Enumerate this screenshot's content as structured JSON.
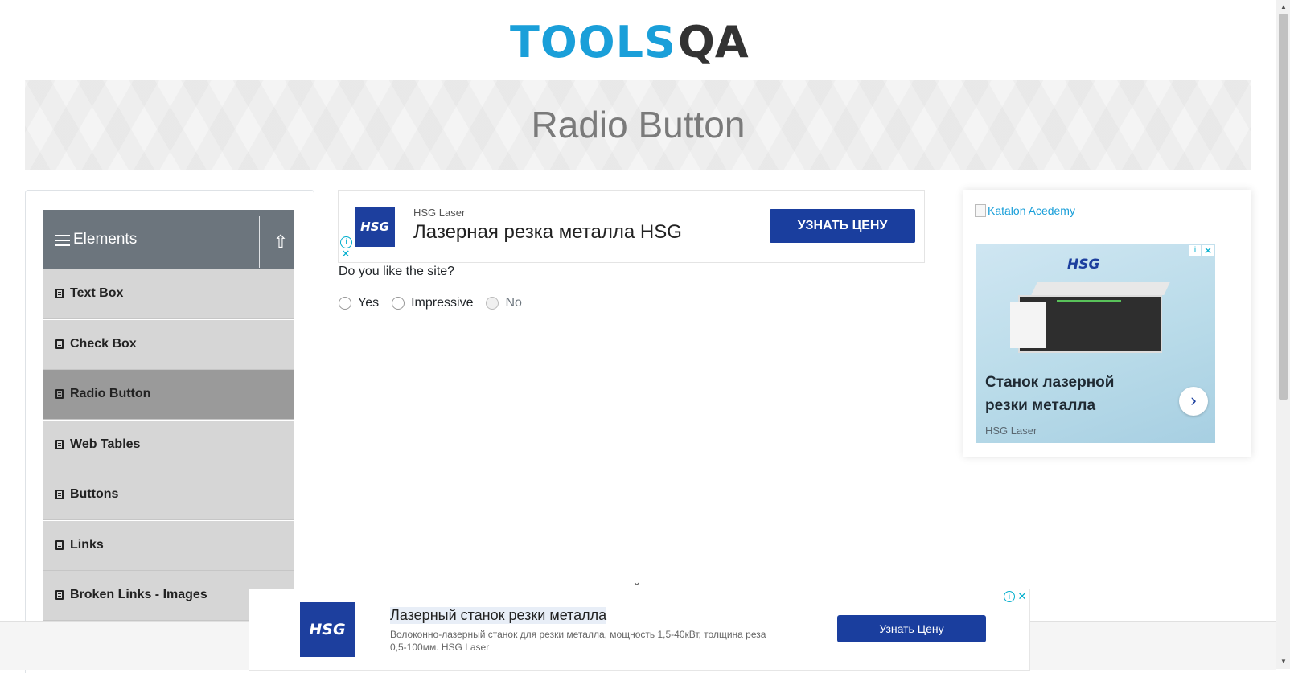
{
  "header": {
    "logo_text_left": "TOOLS",
    "logo_text_right": "QA",
    "page_title": "Radio Button"
  },
  "sidebar": {
    "group_title": "Elements",
    "toggle_symbol": "⇧",
    "items": [
      {
        "label": "Text Box",
        "active": false
      },
      {
        "label": "Check Box",
        "active": false
      },
      {
        "label": "Radio Button",
        "active": true
      },
      {
        "label": "Web Tables",
        "active": false
      },
      {
        "label": "Buttons",
        "active": false
      },
      {
        "label": "Links",
        "active": false
      },
      {
        "label": "Broken Links - Images",
        "active": false
      }
    ]
  },
  "top_ad": {
    "logo": "HSG",
    "brand": "HSG Laser",
    "headline": "Лазерная резка металла HSG",
    "cta": "УЗНАТЬ ЦЕНУ",
    "info_symbol": "i",
    "close_symbol": "✕"
  },
  "form": {
    "question": "Do you like the site?",
    "options": [
      {
        "label": "Yes",
        "disabled": false,
        "checked": false
      },
      {
        "label": "Impressive",
        "disabled": false,
        "checked": false
      },
      {
        "label": "No",
        "disabled": true,
        "checked": false
      }
    ]
  },
  "right_ad": {
    "image_alt": "Katalon Acedemy",
    "card_logo": "HSG",
    "card_title": "Станок лазерной резки металла",
    "card_brand": "HSG Laser",
    "arrow_symbol": "›",
    "info_symbol": "i",
    "close_symbol": "✕"
  },
  "bottom_ad": {
    "collapse_symbol": "⌄",
    "logo": "HSG",
    "headline": "Лазерный станок резки металла",
    "description": "Волоконно-лазерный станок для резки металла, мощность 1,5-40кВт, толщина реза 0,5-100мм. HSG Laser",
    "cta": "Узнать Цену",
    "info_symbol": "i",
    "close_symbol": "✕"
  },
  "scrollbar": {
    "up_symbol": "▲",
    "down_symbol": "▼"
  },
  "colors": {
    "brand_blue": "#1a9fd9",
    "sidebar_header": "#6c757d",
    "menu_item": "#d6d6d6",
    "menu_item_active": "#9a9a9a",
    "ad_cta": "#1a3e9e"
  }
}
